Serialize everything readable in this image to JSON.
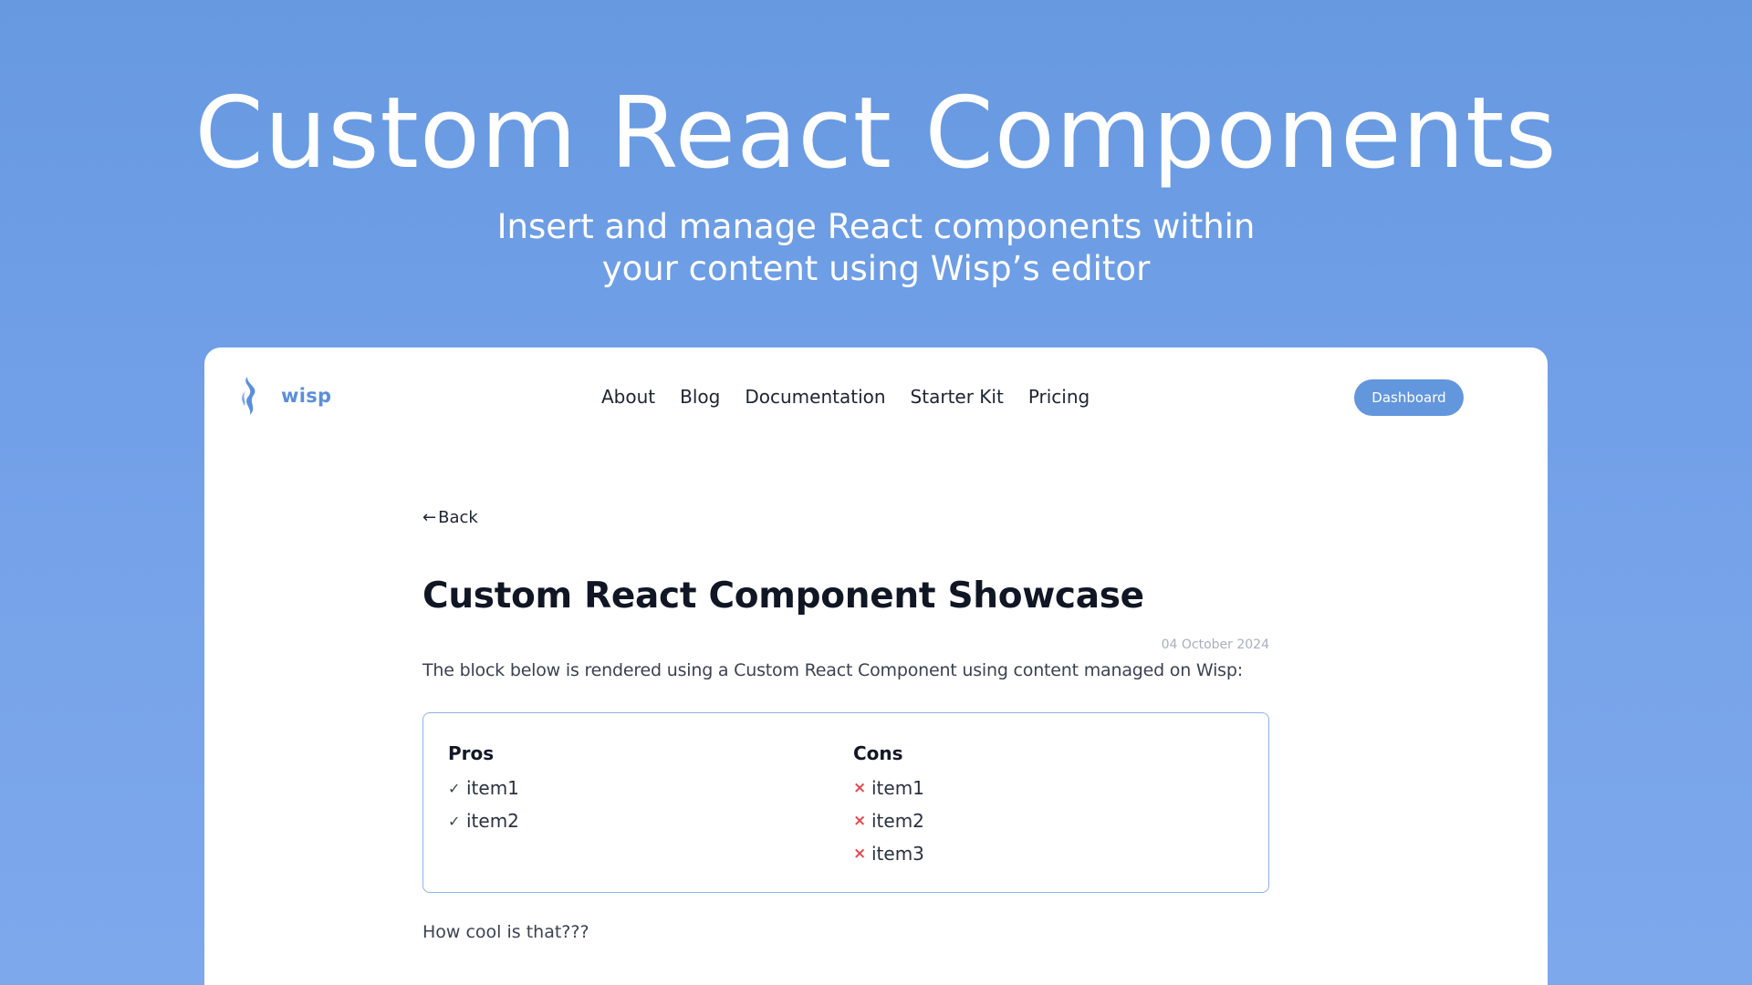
{
  "hero": {
    "title": "Custom React Components",
    "subtitle_line1": "Insert and manage React  components within",
    "subtitle_line2": "your content using Wisp’s editor"
  },
  "nav": {
    "logo_text": "wisp",
    "links": [
      "About",
      "Blog",
      "Documentation",
      "Starter Kit",
      "Pricing"
    ],
    "dashboard_label": "Dashboard"
  },
  "post": {
    "back_label": "Back",
    "title": "Custom React Component Showcase",
    "date": "04 October 2024",
    "intro": "The block below is rendered using a Custom React Component using content managed on Wisp:",
    "outro": "How cool is that???"
  },
  "pros_cons": {
    "pros_heading": "Pros",
    "pros": [
      "item1",
      "item2"
    ],
    "cons_heading": "Cons",
    "cons": [
      "item1",
      "item2",
      "item3"
    ]
  },
  "colors": {
    "background": "#6E9EE6",
    "brand_blue": "#6296DD",
    "cross_red": "#E04B52",
    "box_border": "#8FB0E6"
  },
  "icons": {
    "logo": "flame-logo-icon",
    "back": "arrow-left-icon",
    "pro": "check-icon",
    "con": "cross-icon"
  }
}
